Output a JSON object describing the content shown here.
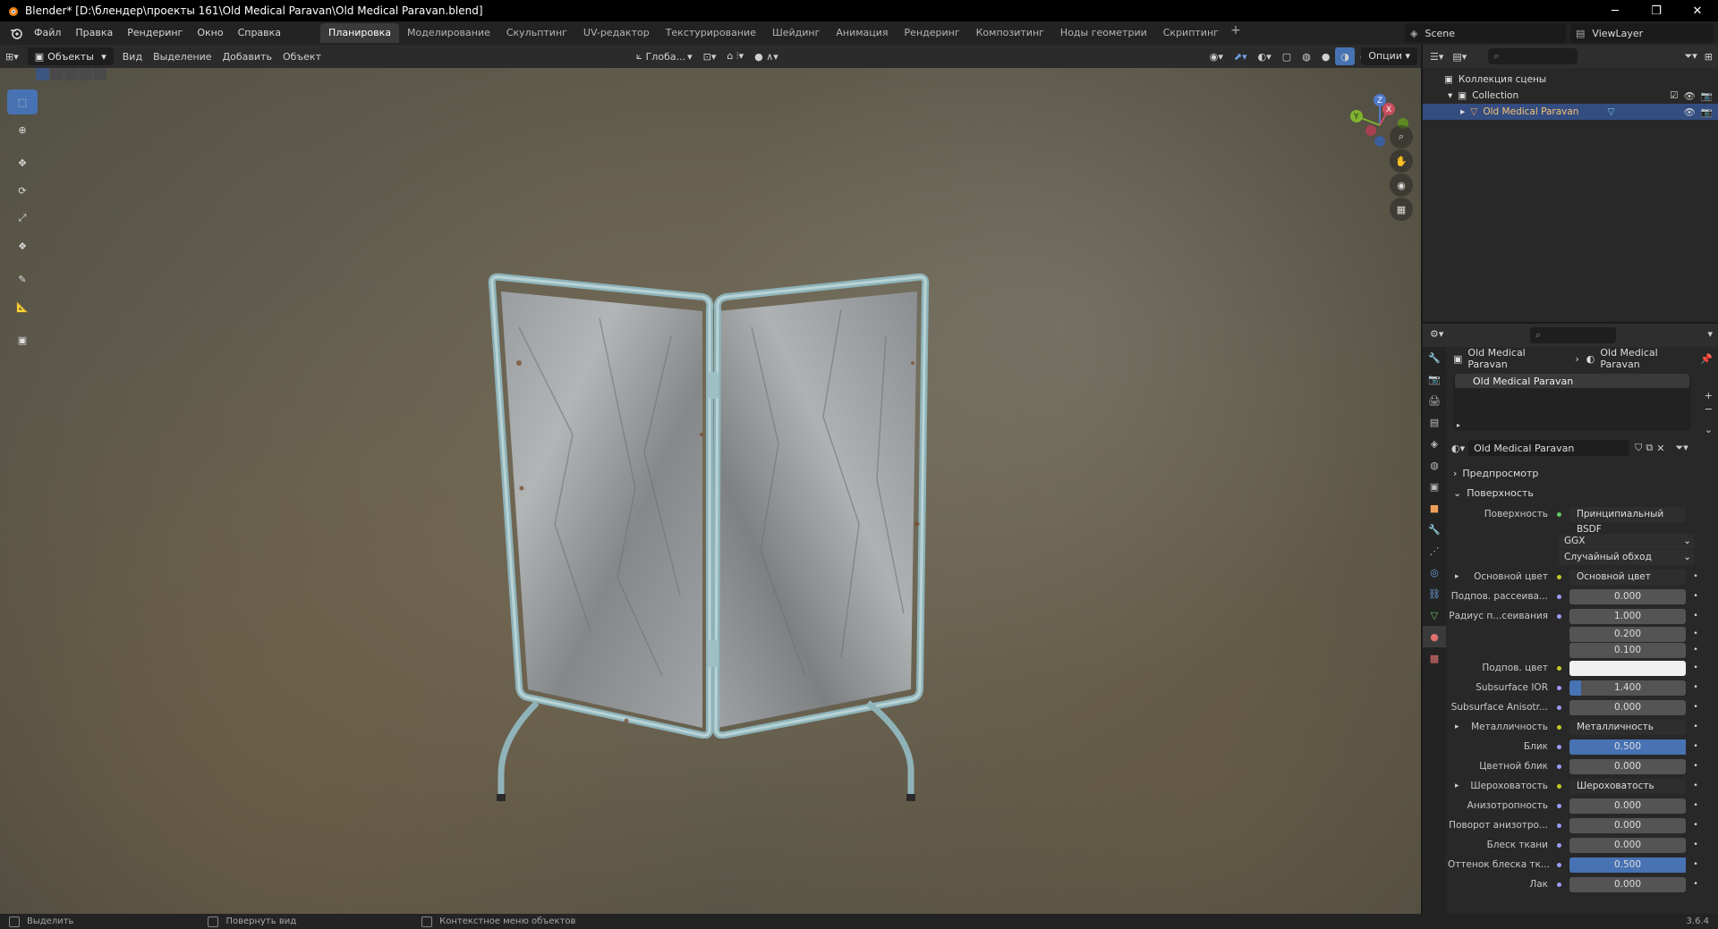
{
  "window": {
    "title": "Blender* [D:\\блендер\\проекты 161\\Old Medical Paravan\\Old Medical Paravan.blend]",
    "minimize": "─",
    "maximize": "❐",
    "close": "✕"
  },
  "menu": {
    "items": [
      "Файл",
      "Правка",
      "Рендеринг",
      "Окно",
      "Справка"
    ]
  },
  "workspaces": {
    "tabs": [
      "Планировка",
      "Моделирование",
      "Скульптинг",
      "UV-редактор",
      "Текстурирование",
      "Шейдинг",
      "Анимация",
      "Рендеринг",
      "Композитинг",
      "Ноды геометрии",
      "Скриптинг"
    ],
    "active": "Планировка",
    "add": "+"
  },
  "scene": {
    "name": "Scene",
    "view_layer": "ViewLayer"
  },
  "viewport_header": {
    "mode": "Объекты",
    "menus": [
      "Вид",
      "Выделение",
      "Добавить",
      "Объект"
    ],
    "orientation": "Глоба...",
    "options": "Опции"
  },
  "outliner": {
    "root": "Коллекция сцены",
    "collection": "Collection",
    "object": "Old Medical Paravan"
  },
  "properties": {
    "breadcrumb_object": "Old Medical Paravan",
    "breadcrumb_material": "Old Medical Paravan",
    "slot": "Old Medical Paravan",
    "material_name": "Old Medical Paravan",
    "panels": {
      "preview": "Предпросмотр",
      "surface": "Поверхность"
    },
    "surface_label": "Поверхность",
    "surface_value": "Принципиальный BSDF",
    "distribution": "GGX",
    "subsurface_method": "Случайный обход",
    "rows": [
      {
        "label": "Основной цвет",
        "value": "Основной цвет",
        "kind": "link",
        "expand": true
      },
      {
        "label": "Подпов. рассеива...",
        "value": "0.000",
        "kind": "num"
      },
      {
        "label": "Радиус п...сеивания",
        "value": "1.000",
        "kind": "num"
      },
      {
        "label": "",
        "value": "0.200",
        "kind": "num"
      },
      {
        "label": "",
        "value": "0.100",
        "kind": "num"
      },
      {
        "label": "Подпов. цвет",
        "value": "",
        "kind": "color"
      },
      {
        "label": "Subsurface IOR",
        "value": "1.400",
        "kind": "num"
      },
      {
        "label": "Subsurface Anisotr...",
        "value": "0.000",
        "kind": "num"
      },
      {
        "label": "Металличность",
        "value": "Металличность",
        "kind": "link",
        "expand": true
      },
      {
        "label": "Блик",
        "value": "0.500",
        "kind": "slider",
        "fill": 1.0
      },
      {
        "label": "Цветной блик",
        "value": "0.000",
        "kind": "num"
      },
      {
        "label": "Шероховатость",
        "value": "Шероховатость",
        "kind": "link",
        "expand": true
      },
      {
        "label": "Анизотропность",
        "value": "0.000",
        "kind": "num"
      },
      {
        "label": "Поворот анизотро...",
        "value": "0.000",
        "kind": "num"
      },
      {
        "label": "Блеск ткани",
        "value": "0.000",
        "kind": "num"
      },
      {
        "label": "Оттенок блеска тк...",
        "value": "0.500",
        "kind": "slider",
        "fill": 1.0
      },
      {
        "label": "Лак",
        "value": "0.000",
        "kind": "num"
      }
    ]
  },
  "status": {
    "select": "Выделить",
    "rotate": "Повернуть вид",
    "context": "Контекстное меню объектов",
    "version": "3.6.4"
  },
  "colors": {
    "accent": "#4772b3",
    "selected_row": "#334d80"
  }
}
